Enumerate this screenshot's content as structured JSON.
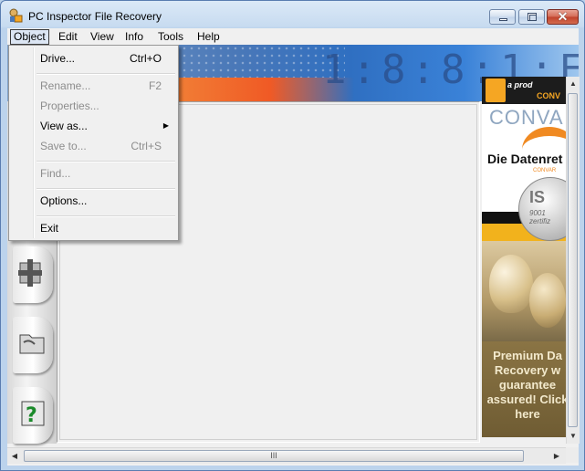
{
  "window": {
    "title": "PC Inspector File Recovery"
  },
  "menubar": {
    "items": [
      "Object",
      "Edit",
      "View",
      "Info",
      "Tools",
      "Help"
    ]
  },
  "object_menu": {
    "items": [
      {
        "label": "Drive...",
        "shortcut": "Ctrl+O",
        "enabled": true
      },
      {
        "label": "Rename...",
        "shortcut": "F2",
        "enabled": false
      },
      {
        "label": "Properties...",
        "shortcut": "",
        "enabled": false
      },
      {
        "label": "View as...",
        "shortcut": "",
        "enabled": true,
        "submenu": true
      },
      {
        "label": "Save to...",
        "shortcut": "Ctrl+S",
        "enabled": false
      },
      {
        "label": "Find...",
        "shortcut": "",
        "enabled": false
      },
      {
        "label": "Options...",
        "shortcut": "",
        "enabled": true
      },
      {
        "label": "Exit",
        "shortcut": "",
        "enabled": true
      }
    ]
  },
  "sidebar": {
    "buttons": [
      "add-drive-icon",
      "folder-open-icon",
      "help-icon"
    ]
  },
  "advert": {
    "tagline": "a prod",
    "brand_small": "CONV",
    "brand": "CONVA",
    "headline": "Die Datenret",
    "sub": "CONVAR",
    "iso": "IS",
    "iso_sub": "9001",
    "iso_cert": "zertifiz",
    "text": "Premium Da Recovery w guarantee assured! Click here"
  },
  "colors": {
    "accent": "#2f6fc1",
    "banner_orange": "#f05a25",
    "ad_gold": "#f5a623"
  },
  "scrollbar_grip": "III"
}
